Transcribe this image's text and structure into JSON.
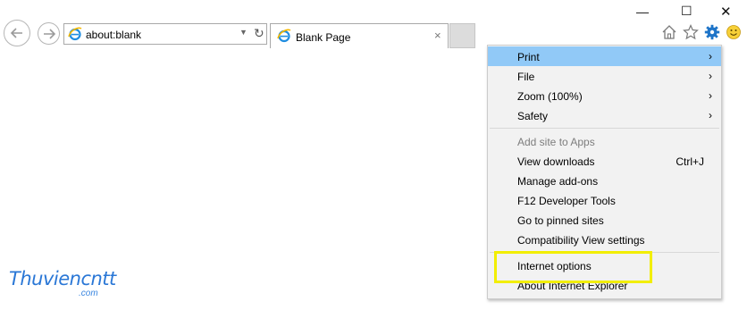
{
  "address": {
    "url": "about:blank"
  },
  "tab": {
    "title": "Blank Page",
    "close_glyph": "×"
  },
  "window": {
    "minimize": "—",
    "maximize": "☐",
    "close": "✕"
  },
  "icons": {
    "back": "back-arrow-icon",
    "forward": "forward-arrow-icon",
    "home": "home-icon",
    "favorites": "star-icon",
    "tools": "gear-icon",
    "feedback": "smiley-icon"
  },
  "menu": {
    "items": [
      {
        "label": "Print",
        "arrow": "›",
        "shortcut": "",
        "highlighted": true,
        "disabled": false
      },
      {
        "label": "File",
        "arrow": "›",
        "shortcut": ""
      },
      {
        "label": "Zoom (100%)",
        "arrow": "›",
        "shortcut": ""
      },
      {
        "label": "Safety",
        "arrow": "›",
        "shortcut": ""
      },
      {
        "label": "Add site to Apps",
        "arrow": "",
        "shortcut": "",
        "disabled": true
      },
      {
        "label": "View downloads",
        "arrow": "",
        "shortcut": "Ctrl+J"
      },
      {
        "label": "Manage add-ons",
        "arrow": "",
        "shortcut": ""
      },
      {
        "label": "F12 Developer Tools",
        "arrow": "",
        "shortcut": ""
      },
      {
        "label": "Go to pinned sites",
        "arrow": "",
        "shortcut": ""
      },
      {
        "label": "Compatibility View settings",
        "arrow": "",
        "shortcut": ""
      },
      {
        "label": "Internet options",
        "arrow": "",
        "shortcut": ""
      },
      {
        "label": "About Internet Explorer",
        "arrow": "",
        "shortcut": ""
      }
    ]
  },
  "watermark": {
    "main": "Thuviencntt",
    "sub": ".com"
  },
  "colors": {
    "menu_highlight": "#91c9f7",
    "annotation_box": "#f2ee00",
    "watermark": "#2a77d6"
  }
}
